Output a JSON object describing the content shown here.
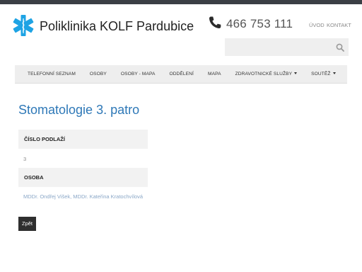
{
  "header": {
    "site_title": "Poliklinika KOLF Pardubice",
    "phone": "466 753 111",
    "links": [
      {
        "label": "ÚVOD"
      },
      {
        "label": "KONTAKT"
      }
    ],
    "search": {
      "placeholder": "",
      "icon": "search-icon"
    }
  },
  "nav": {
    "items": [
      {
        "label": "TELEFONNÍ SEZNAM"
      },
      {
        "label": "OSOBY"
      },
      {
        "label": "OSOBY - MAPA"
      },
      {
        "label": "ODDĚLENÍ"
      },
      {
        "label": "MAPA"
      },
      {
        "label": "ZDRAVOTNICKÉ SLUŽBY",
        "dropdown": true
      },
      {
        "label": "SOUTĚŽ",
        "dropdown": true
      }
    ]
  },
  "main": {
    "title": "Stomatologie 3. patro",
    "fields": [
      {
        "label": "ČÍSLO PODLAŽÍ",
        "value": "3"
      },
      {
        "label": "OSOBA",
        "value": "MDDr. Ondřej Višek, MDDr. Kateřina Kratochvílová"
      }
    ],
    "back_label": "Zpět"
  },
  "colors": {
    "accent": "#2e78b7",
    "logo": "#1ea3e4",
    "topbar": "#3b3f45",
    "nav_bg": "#eeeeee"
  }
}
